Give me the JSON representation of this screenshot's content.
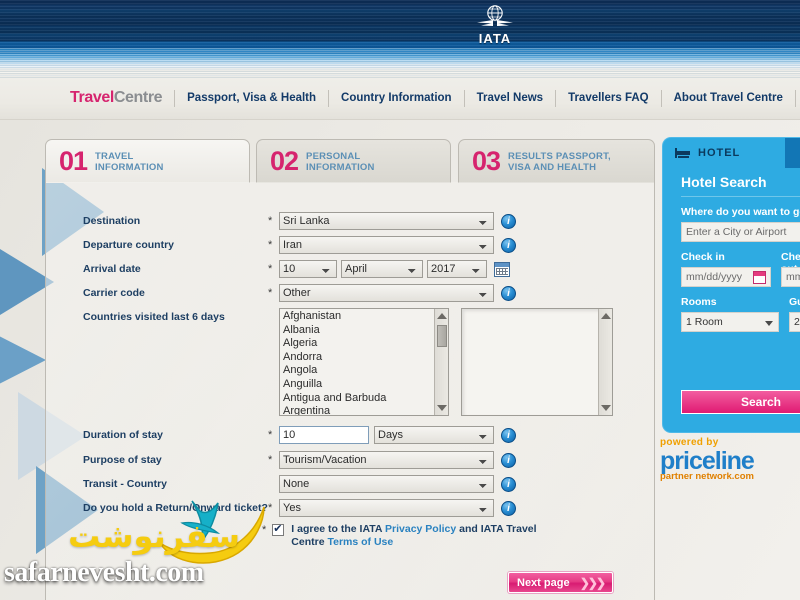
{
  "header": {
    "logo_text": "IATA",
    "logo_icon": "globe-wings-icon"
  },
  "nav": {
    "brand_part1": "Travel",
    "brand_part2": "Centre",
    "links": [
      {
        "label": "Passport, Visa & Health"
      },
      {
        "label": "Country Information"
      },
      {
        "label": "Travel News"
      },
      {
        "label": "Travellers FAQ"
      },
      {
        "label": "About Travel Centre"
      }
    ]
  },
  "tabs": [
    {
      "number": "01",
      "line1": "TRAVEL",
      "line2": "INFORMATION",
      "active": true
    },
    {
      "number": "02",
      "line1": "PERSONAL",
      "line2": "INFORMATION",
      "active": false
    },
    {
      "number": "03",
      "line1": "RESULTS PASSPORT,",
      "line2": "VISA AND HEALTH",
      "active": false
    }
  ],
  "form": {
    "destination": {
      "label": "Destination",
      "required": "*",
      "value": "Sri Lanka",
      "info": "i"
    },
    "departure_country": {
      "label": "Departure country",
      "required": "*",
      "value": "Iran",
      "info": "i"
    },
    "arrival_date": {
      "label": "Arrival date",
      "required": "*",
      "day": "10",
      "month": "April",
      "year": "2017",
      "calendar_icon": "calendar-icon"
    },
    "carrier_code": {
      "label": "Carrier code",
      "required": "*",
      "value": "Other",
      "info": "i"
    },
    "countries_visited": {
      "label": "Countries visited last 6 days",
      "options": [
        "Afghanistan",
        "Albania",
        "Algeria",
        "Andorra",
        "Angola",
        "Anguilla",
        "Antigua and Barbuda",
        "Argentina"
      ],
      "selected_options": []
    },
    "duration_of_stay": {
      "label": "Duration of stay",
      "required": "*",
      "value": "10",
      "unit": "Days",
      "info": "i"
    },
    "purpose_of_stay": {
      "label": "Purpose of stay",
      "required": "*",
      "value": "Tourism/Vacation",
      "info": "i"
    },
    "transit_country": {
      "label": "Transit - Country",
      "required": "",
      "value": "None",
      "info": "i"
    },
    "return_ticket": {
      "label": "Do you hold a Return/Onward ticket?",
      "required": "*",
      "value": "Yes",
      "info": "i"
    },
    "agreement": {
      "required": "*",
      "checked": true,
      "text_part1": "I agree to the IATA ",
      "link1": "Privacy Policy",
      "text_part2": " and IATA Travel Centre ",
      "link2": "Terms of Use"
    },
    "next_button": {
      "label": "Next page",
      "chevron": "chevron-right-triple-icon"
    }
  },
  "sidebar": {
    "hotel_tab_label": "HOTEL",
    "hotel_tab_icon": "bed-icon",
    "title": "Hotel Search",
    "destination_label": "Where do you want to go?",
    "destination_placeholder": "Enter a City or Airport",
    "checkin_label": "Check in",
    "checkin_placeholder": "mm/dd/yyyy",
    "checkout_label": "Check out",
    "checkout_placeholder": "mm/dd/yyyy",
    "rooms_label": "Rooms",
    "rooms_value": "1 Room",
    "guests_label": "Guests",
    "guests_value": "2",
    "search_button": "Search"
  },
  "priceline": {
    "powered_by": "powered by",
    "brand": "priceline",
    "sub": "partner network.com"
  },
  "watermark": {
    "farsi": "سفرنوشت",
    "url": "safarnevesht.com"
  },
  "colors": {
    "accent_pink": "#d6246e",
    "header_blue": "#0d2d56",
    "sidebar_blue": "#2eabe2",
    "label_navy": "#1e3f63",
    "tab_label_blue": "#5b8fb5",
    "link_blue": "#2a82c0"
  }
}
